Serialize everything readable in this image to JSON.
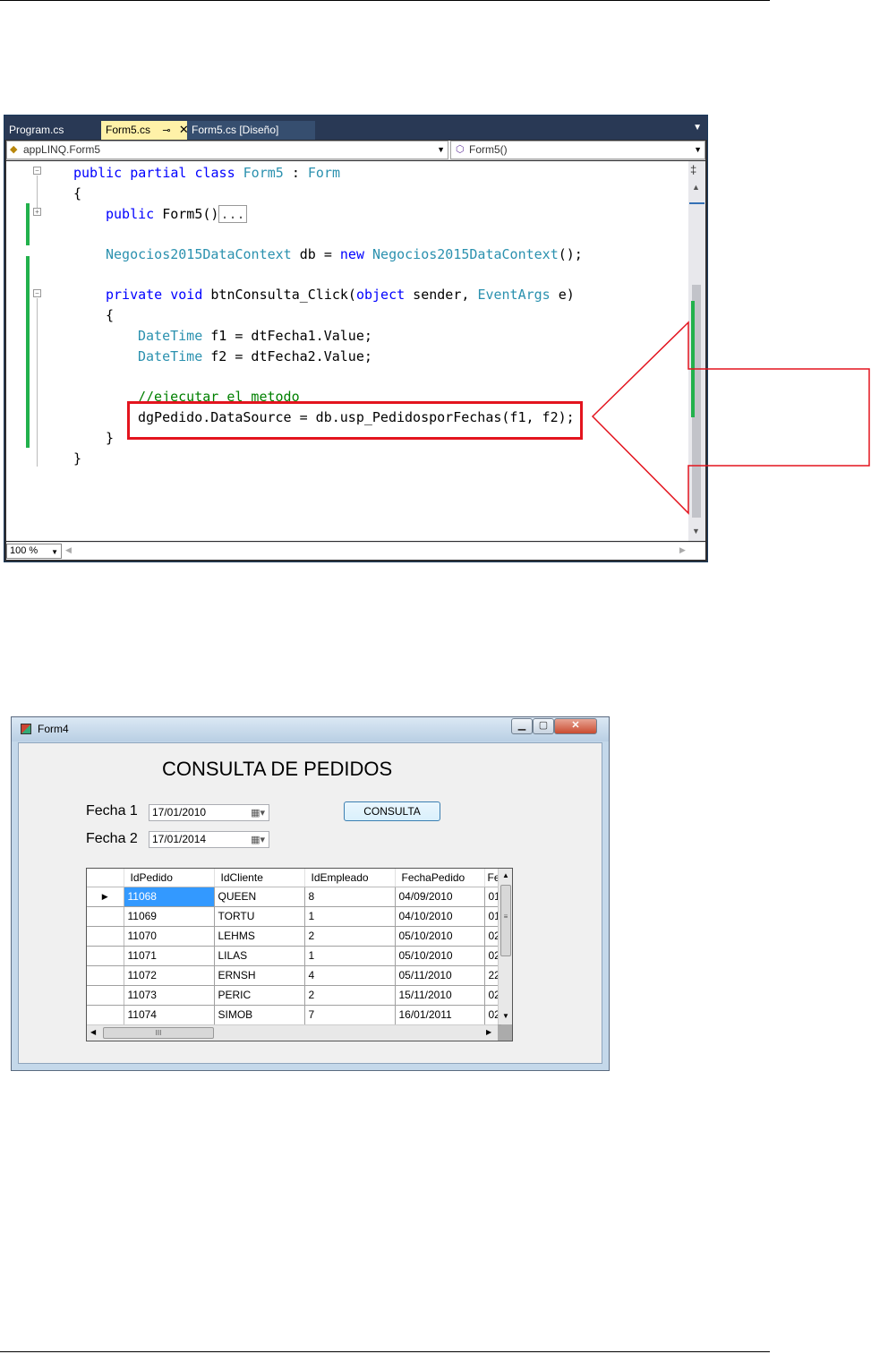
{
  "editor": {
    "tabs": [
      {
        "label": "Program.cs"
      },
      {
        "label": "Form5.cs"
      },
      {
        "label": "Form5.cs [Diseño]"
      }
    ],
    "pin_icon": "⊸",
    "close_icon": "✕",
    "nav_left": "appLINQ.Form5",
    "nav_right": "Form5()",
    "zoom": "100 %",
    "code": {
      "l1_kw": "public partial class ",
      "l1_ty1": "Form5",
      "l1_sep": " : ",
      "l1_ty2": "Form",
      "l2": "{",
      "l3_kw": "public ",
      "l3_name": "Form5()",
      "l3_collapsed": "...",
      "l4_ty": "Negocios2015DataContext",
      "l4_mid": " db = ",
      "l4_kw": "new ",
      "l4_ty2": "Negocios2015DataContext",
      "l4_end": "();",
      "l5_kw": "private void ",
      "l5_name": "btnConsulta_Click(",
      "l5_kw2": "object",
      "l5_mid": " sender, ",
      "l5_ty": "EventArgs",
      "l5_end": " e)",
      "l6": "{",
      "l7_ty": "DateTime",
      "l7_rest": " f1 = dtFecha1.Value;",
      "l8_ty": "DateTime",
      "l8_rest": " f2 = dtFecha2.Value;",
      "l9_comment": "//ejecutar el metodo",
      "l10": "dgPedido.DataSource = db.usp_PedidosporFechas(f1, f2);",
      "l11": "}",
      "l12": "}"
    }
  },
  "form": {
    "window_title": "Form4",
    "heading": "CONSULTA DE PEDIDOS",
    "fecha1_label": "Fecha 1",
    "fecha1_value": "17/01/2010",
    "fecha2_label": "Fecha 2",
    "fecha2_value": "17/01/2014",
    "button_label": "CONSULTA",
    "grid": {
      "columns": [
        "IdPedido",
        "IdCliente",
        "IdEmpleado",
        "FechaPedido",
        "Fe"
      ],
      "rows": [
        [
          "11068",
          "QUEEN",
          "8",
          "04/09/2010",
          "01"
        ],
        [
          "11069",
          "TORTU",
          "1",
          "04/10/2010",
          "01"
        ],
        [
          "11070",
          "LEHMS",
          "2",
          "05/10/2010",
          "02"
        ],
        [
          "11071",
          "LILAS",
          "1",
          "05/10/2010",
          "02"
        ],
        [
          "11072",
          "ERNSH",
          "4",
          "05/11/2010",
          "22"
        ],
        [
          "11073",
          "PERIC",
          "2",
          "15/11/2010",
          "02"
        ],
        [
          "11074",
          "SIMOB",
          "7",
          "16/01/2011",
          "02"
        ]
      ],
      "selected_row_marker": "▶",
      "scroll_grip_v": "≡",
      "scroll_grip_h": "III"
    }
  }
}
